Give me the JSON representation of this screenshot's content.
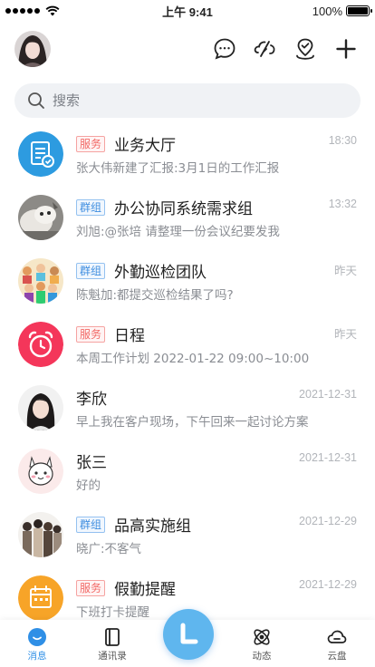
{
  "status_bar": {
    "time": "上午 9:41",
    "battery": "100%"
  },
  "search": {
    "placeholder": "搜索"
  },
  "header": {
    "icons": [
      "chat-bubble-icon",
      "cloud-link-icon",
      "location-check-icon",
      "plus-icon"
    ]
  },
  "conversations": [
    {
      "type_badge": "服务",
      "badge_kind": "service",
      "title": "业务大厅",
      "preview": "张大伟新建了汇报:3月1日的工作汇报",
      "time": "18:30"
    },
    {
      "type_badge": "群组",
      "badge_kind": "group",
      "title": "办公协同系统需求组",
      "preview": "刘旭:@张培  请整理一份会议纪要发我",
      "time": "13:32"
    },
    {
      "type_badge": "群组",
      "badge_kind": "group",
      "title": "外勤巡检团队",
      "preview": "陈魁加:都提交巡检结果了吗?",
      "time": "昨天"
    },
    {
      "type_badge": "服务",
      "badge_kind": "service",
      "title": "日程",
      "preview": "本周工作计划  2022-01-22  09:00~10:00",
      "time": "昨天"
    },
    {
      "type_badge": "",
      "badge_kind": "",
      "title": "李欣",
      "preview": "早上我在客户现场，下午回来一起讨论方案",
      "time": "2021-12-31"
    },
    {
      "type_badge": "",
      "badge_kind": "",
      "title": "张三",
      "preview": "好的",
      "time": "2021-12-31"
    },
    {
      "type_badge": "群组",
      "badge_kind": "group",
      "title": "品高实施组",
      "preview": "晓广:不客气",
      "time": "2021-12-29"
    },
    {
      "type_badge": "服务",
      "badge_kind": "service",
      "title": "假勤提醒",
      "preview": "下班打卡提醒",
      "time": "2021-12-29"
    }
  ],
  "tabbar": {
    "tabs": [
      {
        "label": "消息",
        "icon": "message-icon"
      },
      {
        "label": "通讯录",
        "icon": "contacts-icon"
      },
      {
        "label": "",
        "icon": "home-fab-icon"
      },
      {
        "label": "动态",
        "icon": "activity-icon"
      },
      {
        "label": "云盘",
        "icon": "cloud-drive-icon"
      }
    ],
    "active_color": "#2f8fe6"
  }
}
